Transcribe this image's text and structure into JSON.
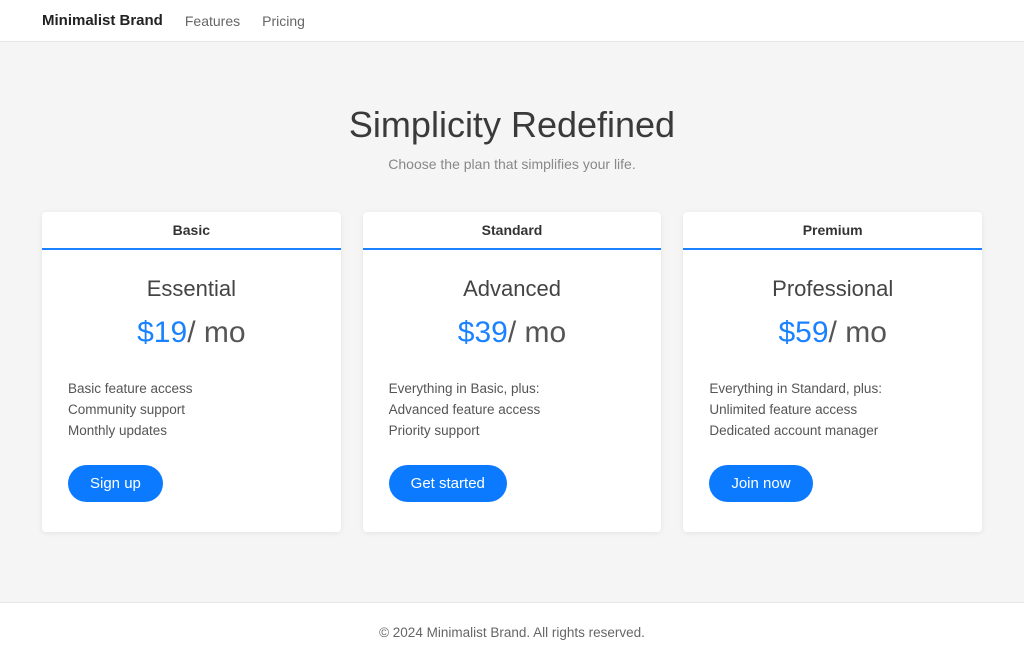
{
  "header": {
    "brand": "Minimalist Brand",
    "nav": [
      "Features",
      "Pricing"
    ]
  },
  "hero": {
    "title": "Simplicity Redefined",
    "subtitle": "Choose the plan that simplifies your life."
  },
  "plans": [
    {
      "tier": "Basic",
      "name": "Essential",
      "price": "$19",
      "period": "/ mo",
      "features": [
        "Basic feature access",
        "Community support",
        "Monthly updates"
      ],
      "cta": "Sign up"
    },
    {
      "tier": "Standard",
      "name": "Advanced",
      "price": "$39",
      "period": "/ mo",
      "features": [
        "Everything in Basic, plus:",
        "Advanced feature access",
        "Priority support"
      ],
      "cta": "Get started"
    },
    {
      "tier": "Premium",
      "name": "Professional",
      "price": "$59",
      "period": "/ mo",
      "features": [
        "Everything in Standard, plus:",
        "Unlimited feature access",
        "Dedicated account manager"
      ],
      "cta": "Join now"
    }
  ],
  "footer": {
    "copyright": "© 2024 Minimalist Brand. All rights reserved."
  }
}
